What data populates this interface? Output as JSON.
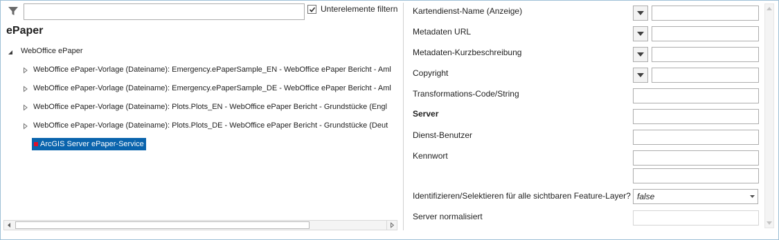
{
  "filter": {
    "placeholder": "",
    "value": "",
    "checkbox_label": "Unterelemente filtern",
    "checkbox_checked": true
  },
  "tree": {
    "title": "ePaper",
    "root": {
      "label": "WebOffice ePaper",
      "expanded": true
    },
    "children": [
      {
        "label": "WebOffice ePaper-Vorlage (Dateiname): Emergency.ePaperSample_EN - WebOffice ePaper Bericht - Aml"
      },
      {
        "label": "WebOffice ePaper-Vorlage (Dateiname): Emergency.ePaperSample_DE - WebOffice ePaper Bericht - Aml"
      },
      {
        "label": "WebOffice ePaper-Vorlage (Dateiname): Plots.Plots_EN - WebOffice ePaper Bericht - Grundstücke (Engl"
      },
      {
        "label": "WebOffice ePaper-Vorlage (Dateiname): Plots.Plots_DE - WebOffice ePaper Bericht - Grundstücke (Deut"
      }
    ],
    "selected": {
      "label": "ArcGIS Server ePaper-Service"
    }
  },
  "properties": {
    "kartendienst_name": {
      "label": "Kartendienst-Name (Anzeige)",
      "value": ""
    },
    "metadaten_url": {
      "label": "Metadaten URL",
      "value": ""
    },
    "metadaten_kurz": {
      "label": "Metadaten-Kurzbeschreibung",
      "value": ""
    },
    "copyright": {
      "label": "Copyright",
      "value": ""
    },
    "transformations": {
      "label": "Transformations-Code/String",
      "value": ""
    },
    "server": {
      "label": "Server",
      "value": ""
    },
    "dienst_benutzer": {
      "label": "Dienst-Benutzer",
      "value": ""
    },
    "kennwort": {
      "label": "Kennwort",
      "value": "",
      "confirm_value": ""
    },
    "identifizieren": {
      "label": "Identifizieren/Selektieren für alle sichtbaren Feature-Layer?",
      "value": "false"
    },
    "server_normalisiert": {
      "label": "Server normalisiert",
      "value": ""
    }
  },
  "icons": {
    "filter": "filter-funnel-icon",
    "expand_open": "triangle-down-icon",
    "expand_closed": "triangle-right-icon",
    "dropdown": "chevron-down-icon",
    "node_state": "red-square-icon"
  },
  "colors": {
    "selection": "#0a64ad",
    "selection_text": "#ffffff",
    "state_dot": "#e0102a",
    "frame": "#9ebfd6"
  }
}
